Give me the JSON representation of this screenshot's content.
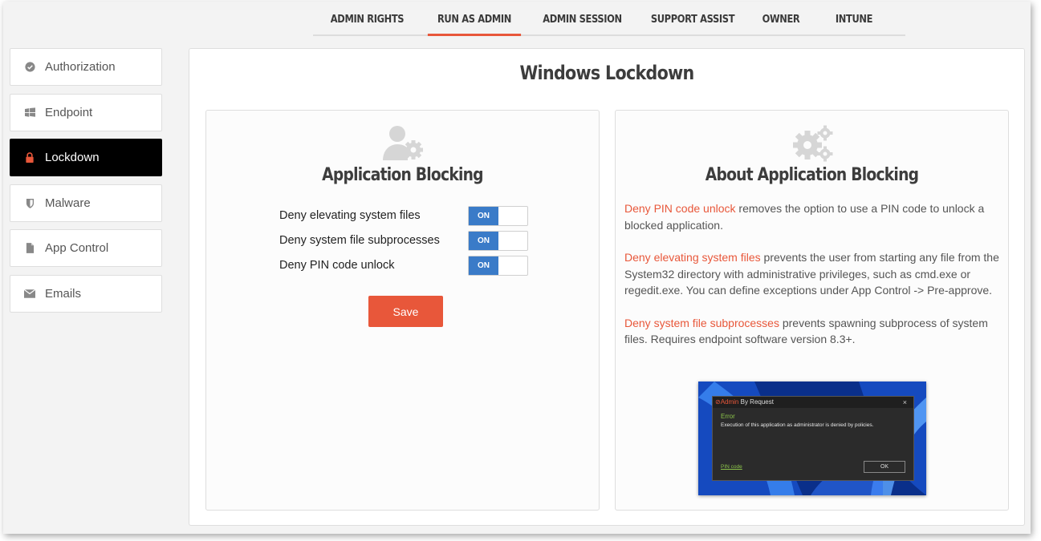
{
  "top_tabs": [
    {
      "label": "ADMIN RIGHTS",
      "active": false
    },
    {
      "label": "RUN AS ADMIN",
      "active": true
    },
    {
      "label": "ADMIN SESSION",
      "active": false
    },
    {
      "label": "SUPPORT ASSIST",
      "active": false
    },
    {
      "label": "OWNER",
      "active": false
    },
    {
      "label": "INTUNE",
      "active": false
    }
  ],
  "sidebar": {
    "items": [
      {
        "label": "Authorization",
        "icon": "check-circle-icon",
        "active": false
      },
      {
        "label": "Endpoint",
        "icon": "windows-icon",
        "active": false
      },
      {
        "label": "Lockdown",
        "icon": "lock-icon",
        "active": true
      },
      {
        "label": "Malware",
        "icon": "shield-icon",
        "active": false
      },
      {
        "label": "App Control",
        "icon": "file-icon",
        "active": false
      },
      {
        "label": "Emails",
        "icon": "envelope-icon",
        "active": false
      }
    ]
  },
  "main": {
    "title": "Windows Lockdown",
    "left_card": {
      "title": "Application Blocking",
      "icon": "user-gear-icon",
      "toggles": [
        {
          "label": "Deny elevating system files",
          "state": "ON"
        },
        {
          "label": "Deny system file subprocesses",
          "state": "ON"
        },
        {
          "label": "Deny PIN code unlock",
          "state": "ON"
        }
      ],
      "save_label": "Save"
    },
    "right_card": {
      "title": "About Application Blocking",
      "icon": "gears-icon",
      "paragraphs": [
        {
          "highlight": "Deny PIN code unlock",
          "text": " removes the option to use a PIN code to unlock a blocked application."
        },
        {
          "highlight": "Deny elevating system files",
          "text": " prevents the user from starting any file from the System32 directory with administrative privileges, such as cmd.exe or regedit.exe. You can define exceptions under App Control -> Pre-approve."
        },
        {
          "highlight": "Deny system file subprocesses",
          "text": " prevents spawning subprocess of system files. Requires endpoint software version 8.3+."
        }
      ],
      "screenshot": {
        "brand_prefix": "Admin",
        "brand_suffix": " By Request",
        "close": "×",
        "error_title": "Error",
        "message": "Execution of this application as administrator is denied by policies.",
        "pin_link": "PIN code",
        "ok_label": "OK"
      }
    }
  },
  "colors": {
    "accent": "#e8573a",
    "toggle_on": "#3a7bc8",
    "active_nav": "#000000"
  }
}
